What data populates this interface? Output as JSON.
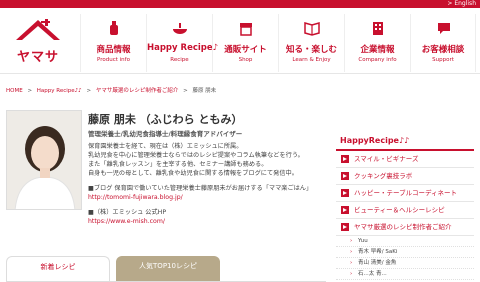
{
  "topbar": {
    "english_link": "> English"
  },
  "logo": {
    "text": "ヤマサ"
  },
  "nav": [
    {
      "jp": "商品情報",
      "en": "Product info",
      "icon": "bottle-icon"
    },
    {
      "jp": "Happy Recipe♪",
      "en": "Recipe",
      "icon": "dish-icon"
    },
    {
      "jp": "通販サイト",
      "en": "Shop",
      "icon": "shop-icon"
    },
    {
      "jp": "知る・楽しむ",
      "en": "Learn & Enjoy",
      "icon": "book-icon"
    },
    {
      "jp": "企業情報",
      "en": "Company info",
      "icon": "building-icon"
    },
    {
      "jp": "お客様相談",
      "en": "Support",
      "icon": "chat-icon"
    }
  ],
  "breadcrumb": [
    "HOME",
    ">",
    "Happy Recipe♪♪",
    ">",
    "ヤマサ厳選のレシピ制作者ご紹介",
    ">",
    "藤原 朋未"
  ],
  "profile": {
    "name": "藤原 朋未 （ふじわら ともみ）",
    "titles": "管理栄養士/乳幼児食指導士/料理縁食育アドバイザー",
    "bio_lines": [
      "保育園栄養士を経て、現在は（株）エミッシュに所属。",
      "乳幼児食を中心に管理栄養士ならではのレシピ提案やコラム執筆などを行う。",
      "また「離乳食レッスン」を主宰する他、セミナー講師も務める。",
      "自身も一児の母として、離乳食や幼児食に関する情報をブログにて発信中。"
    ],
    "blog_label": "■ブログ 保育園で働いていた管理栄養士藤原朋未がお届けする「ママ楽ごはん」",
    "blog_url": "http://tomomi-fujiwara.blog.jp/",
    "company_label": "■（株）エミッシュ 公式HP",
    "company_url": "https://www.e-mish.com/"
  },
  "tabs": {
    "new": "新着レシピ",
    "top": "人気TOP10レシピ"
  },
  "sidebar": {
    "title": "HappyRecipe♪♪",
    "items": [
      "スマイル・ビギナーズ",
      "クッキング裏技ラボ",
      "ハッピー・テーブルコーディネート",
      "ビューティー＆ヘルシーレシピ",
      "ヤマサ厳選のレシピ制作者ご紹介"
    ],
    "sub_items": [
      "Yuu",
      "青木 早希/ SaKi",
      "青山 清美/ 金魚",
      "石...太 青..."
    ]
  },
  "colors": {
    "brand": "#c8102e",
    "tab_active": "#b7a98a"
  }
}
